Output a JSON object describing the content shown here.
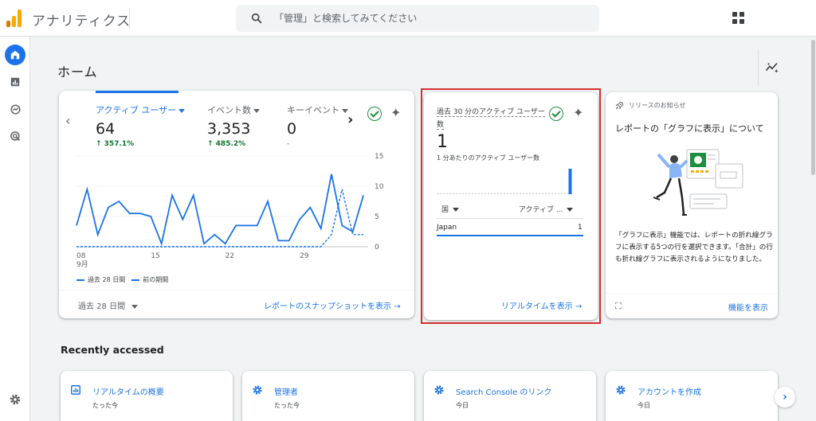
{
  "app": {
    "title": "アナリティクス"
  },
  "search": {
    "placeholder": "「管理」と検索してみてください"
  },
  "page": {
    "title": "ホーム"
  },
  "overview": {
    "metrics": [
      {
        "label": "アクティブ ユーザー",
        "value": "64",
        "delta": "↑ 357.1%"
      },
      {
        "label": "イベント数",
        "value": "3,353",
        "delta": "↑ 485.2%"
      },
      {
        "label": "キーイベント",
        "value": "0",
        "delta": "-"
      }
    ],
    "chart_data": {
      "type": "line",
      "x_tick_labels": [
        "08",
        "15",
        "22",
        "29"
      ],
      "x_month_label": "9月",
      "y_tick_labels": [
        "15",
        "10",
        "5",
        "0"
      ],
      "ylim": [
        0,
        15
      ],
      "series": [
        {
          "name": "過去 28 日間",
          "style": "solid",
          "values": [
            3.5,
            9.5,
            2,
            6.5,
            7.5,
            5.5,
            5.5,
            5,
            0.5,
            8.5,
            4.5,
            8.5,
            0.5,
            2,
            0.5,
            3.5,
            3.5,
            3.5,
            7.5,
            1,
            1,
            4.5,
            6.5,
            3,
            12,
            3.5,
            2.5,
            8.5
          ]
        },
        {
          "name": "前の期間",
          "style": "dashed",
          "values": [
            0,
            0,
            0,
            0,
            0,
            0,
            0,
            0,
            0,
            0,
            0,
            0,
            0,
            0,
            0,
            0,
            0,
            0,
            0,
            0,
            0,
            0,
            0,
            0,
            2,
            9.5,
            2,
            2
          ]
        }
      ],
      "color": "#1a73e8"
    },
    "date_range": "過去 28 日間",
    "snapshot_link": "レポートのスナップショットを表示"
  },
  "realtime": {
    "title": "過去 30 分のアクティブ ユーザー数",
    "value": "1",
    "subtitle": "1 分あたりのアクティブ ユーザー数",
    "bars": [
      0,
      0,
      0,
      0,
      0,
      0,
      0,
      0,
      0,
      0,
      0,
      0,
      0,
      0,
      0,
      0,
      0,
      0,
      0,
      0,
      0,
      0,
      0,
      0,
      0,
      0,
      0,
      0,
      0,
      1
    ],
    "col_country": "国",
    "col_active": "アクティブ ...",
    "rows": [
      {
        "country": "Japan",
        "value": "1"
      }
    ],
    "link": "リアルタイムを表示"
  },
  "release": {
    "header": "リリースのお知らせ",
    "title": "レポートの「グラフに表示」について",
    "body": "「グラフに表示」機能では、レポートの折れ線グラフに表示する5つの行を選択できます。「合計」の行も折れ線グラフに表示されるようになりました。",
    "link": "機能を表示"
  },
  "recent": {
    "title": "Recently accessed",
    "items": [
      {
        "name": "リアルタイムの概要",
        "time": "たった今",
        "icon": "report-icon"
      },
      {
        "name": "管理者",
        "time": "たった今",
        "icon": "gear-icon"
      },
      {
        "name": "Search Console のリンク",
        "time": "今日",
        "icon": "gear-icon"
      },
      {
        "name": "アカウントを作成",
        "time": "今日",
        "icon": "gear-icon"
      }
    ]
  },
  "colors": {
    "accent": "#1a73e8",
    "positive": "#137333",
    "highlight": "#d32f2f",
    "logo_orange": "#f9ab00",
    "logo_dark": "#e37400"
  }
}
